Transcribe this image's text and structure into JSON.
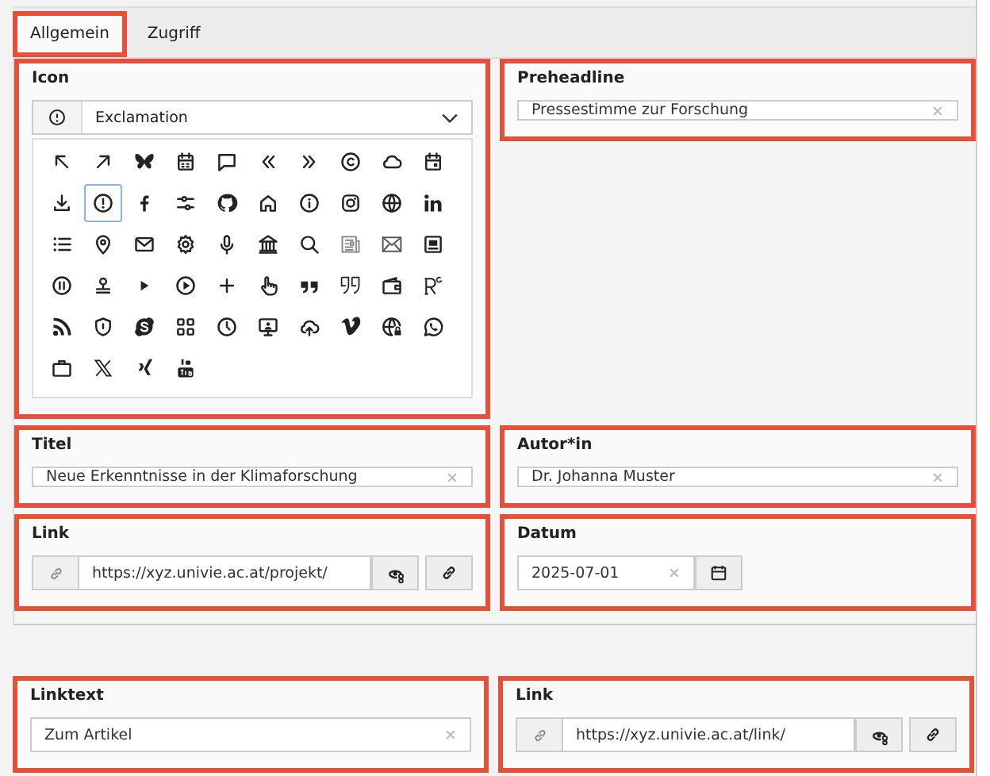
{
  "tabs": [
    {
      "label": "Allgemein",
      "selected": true,
      "highlighted": true
    },
    {
      "label": "Zugriff",
      "selected": false,
      "highlighted": false
    }
  ],
  "icon_field": {
    "label": "Icon",
    "highlighted": true,
    "select_value": "Exclamation",
    "icons": [
      {
        "selected": false
      },
      {
        "selected": false
      },
      {
        "selected": false
      },
      {
        "selected": false
      },
      {
        "selected": false
      },
      {
        "selected": false
      },
      {
        "selected": false
      },
      {
        "selected": false
      },
      {
        "selected": false
      },
      {
        "selected": false
      },
      {
        "selected": false
      },
      {
        "selected": true
      },
      {
        "selected": false
      },
      {
        "selected": false
      },
      {
        "selected": false
      },
      {
        "selected": false
      },
      {
        "selected": false
      },
      {
        "selected": false
      },
      {
        "selected": false
      },
      {
        "selected": false
      },
      {
        "selected": false
      },
      {
        "selected": false
      },
      {
        "selected": false
      },
      {
        "selected": false
      },
      {
        "selected": false
      },
      {
        "selected": false
      },
      {
        "selected": false
      },
      {
        "selected": false
      },
      {
        "selected": false
      },
      {
        "selected": false
      },
      {
        "selected": false
      },
      {
        "selected": false
      },
      {
        "selected": false
      },
      {
        "selected": false
      },
      {
        "selected": false
      },
      {
        "selected": false
      },
      {
        "selected": false
      },
      {
        "selected": false
      },
      {
        "selected": false
      },
      {
        "selected": false
      },
      {
        "selected": false
      },
      {
        "selected": false
      },
      {
        "selected": false
      },
      {
        "selected": false
      },
      {
        "selected": false
      },
      {
        "selected": false
      },
      {
        "selected": false
      },
      {
        "selected": false
      },
      {
        "selected": false
      },
      {
        "selected": false
      },
      {
        "selected": false
      },
      {
        "selected": false
      },
      {
        "selected": false
      },
      {
        "selected": false
      }
    ]
  },
  "side_field": {
    "kind": "text",
    "label": "Preheadline",
    "value": "Pressestimme zur Forschung",
    "highlighted": true
  },
  "rows": [
    [
      {
        "kind": "text",
        "label": "Titel",
        "value": "Neue Erkenntnisse in der Klimaforschung",
        "highlighted": true
      },
      {
        "kind": "text",
        "label": "Autor*in",
        "value": "Dr. Johanna Muster",
        "highlighted": true
      }
    ],
    [
      {
        "kind": "link",
        "label": "Link",
        "value": "https://xyz.univie.ac.at/projekt/",
        "highlighted": true
      },
      {
        "kind": "date",
        "label": "Datum",
        "value": "2025-07-01",
        "highlighted": true
      }
    ]
  ],
  "second_rows": [
    [
      {
        "kind": "text",
        "label": "Linktext",
        "value": "Zum Artikel",
        "highlighted": true
      },
      {
        "kind": "link",
        "label": "Link",
        "value": "https://xyz.univie.ac.at/link/",
        "highlighted": true
      }
    ]
  ]
}
